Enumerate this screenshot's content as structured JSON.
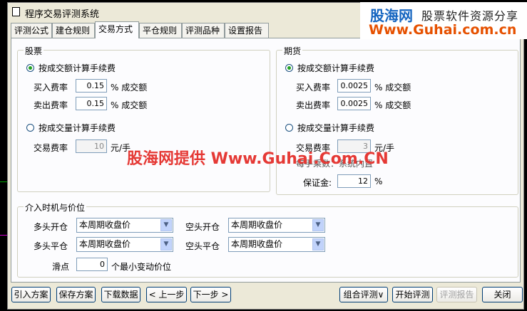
{
  "window": {
    "title": "程序交易评测系统",
    "close_glyph": "×"
  },
  "watermark": {
    "logo": "股海网",
    "slogan": "股票软件资源分享",
    "url": "Www.Guhai.com.cn",
    "middle": "股海网提供 Www.Guhai.Com.CN"
  },
  "tabs": [
    {
      "label": "评测公式"
    },
    {
      "label": "建仓规则"
    },
    {
      "label": "交易方式"
    },
    {
      "label": "平仓规则"
    },
    {
      "label": "评测品种"
    },
    {
      "label": "设置报告"
    }
  ],
  "stock": {
    "title": "股票",
    "opt_amount": "按成交额计算手续费",
    "buy_label": "买入费率",
    "buy_value": "0.15",
    "buy_unit": "% 成交额",
    "sell_label": "卖出费率",
    "sell_value": "0.15",
    "sell_unit": "% 成交额",
    "opt_volume": "按成交量计算手续费",
    "fee_label": "交易费率",
    "fee_value": "10",
    "fee_unit": "元/手"
  },
  "futures": {
    "title": "期货",
    "opt_amount": "按成交额计算手续费",
    "buy_label": "买入费率",
    "buy_value": "0.0025",
    "buy_unit": "% 成交额",
    "sell_label": "卖出费率",
    "sell_value": "0.0025",
    "sell_unit": "% 成交额",
    "opt_volume": "按成交量计算手续费",
    "fee_label": "交易费率",
    "fee_value": "3",
    "fee_unit": "元/手",
    "lots_label": "每手乘数：系统内置",
    "margin_label": "保证金:",
    "margin_value": "12",
    "margin_unit": "%"
  },
  "timing": {
    "title": "介入时机与价位",
    "long_open_label": "多头开仓",
    "long_open_value": "本周期收盘价",
    "short_open_label": "空头开仓",
    "short_open_value": "本周期收盘价",
    "long_close_label": "多头平仓",
    "long_close_value": "本周期收盘价",
    "short_close_label": "空头平仓",
    "short_close_value": "本周期收盘价",
    "slip_label": "滑点",
    "slip_value": "0",
    "slip_unit": "个最小变动价位"
  },
  "buttons": {
    "import": "引入方案",
    "save": "保存方案",
    "download": "下载数据",
    "prev": "< 上一步",
    "next": "下一步 >",
    "combo": "组合评测∨",
    "start": "开始评测",
    "report": "评测报告",
    "close": "关闭"
  }
}
